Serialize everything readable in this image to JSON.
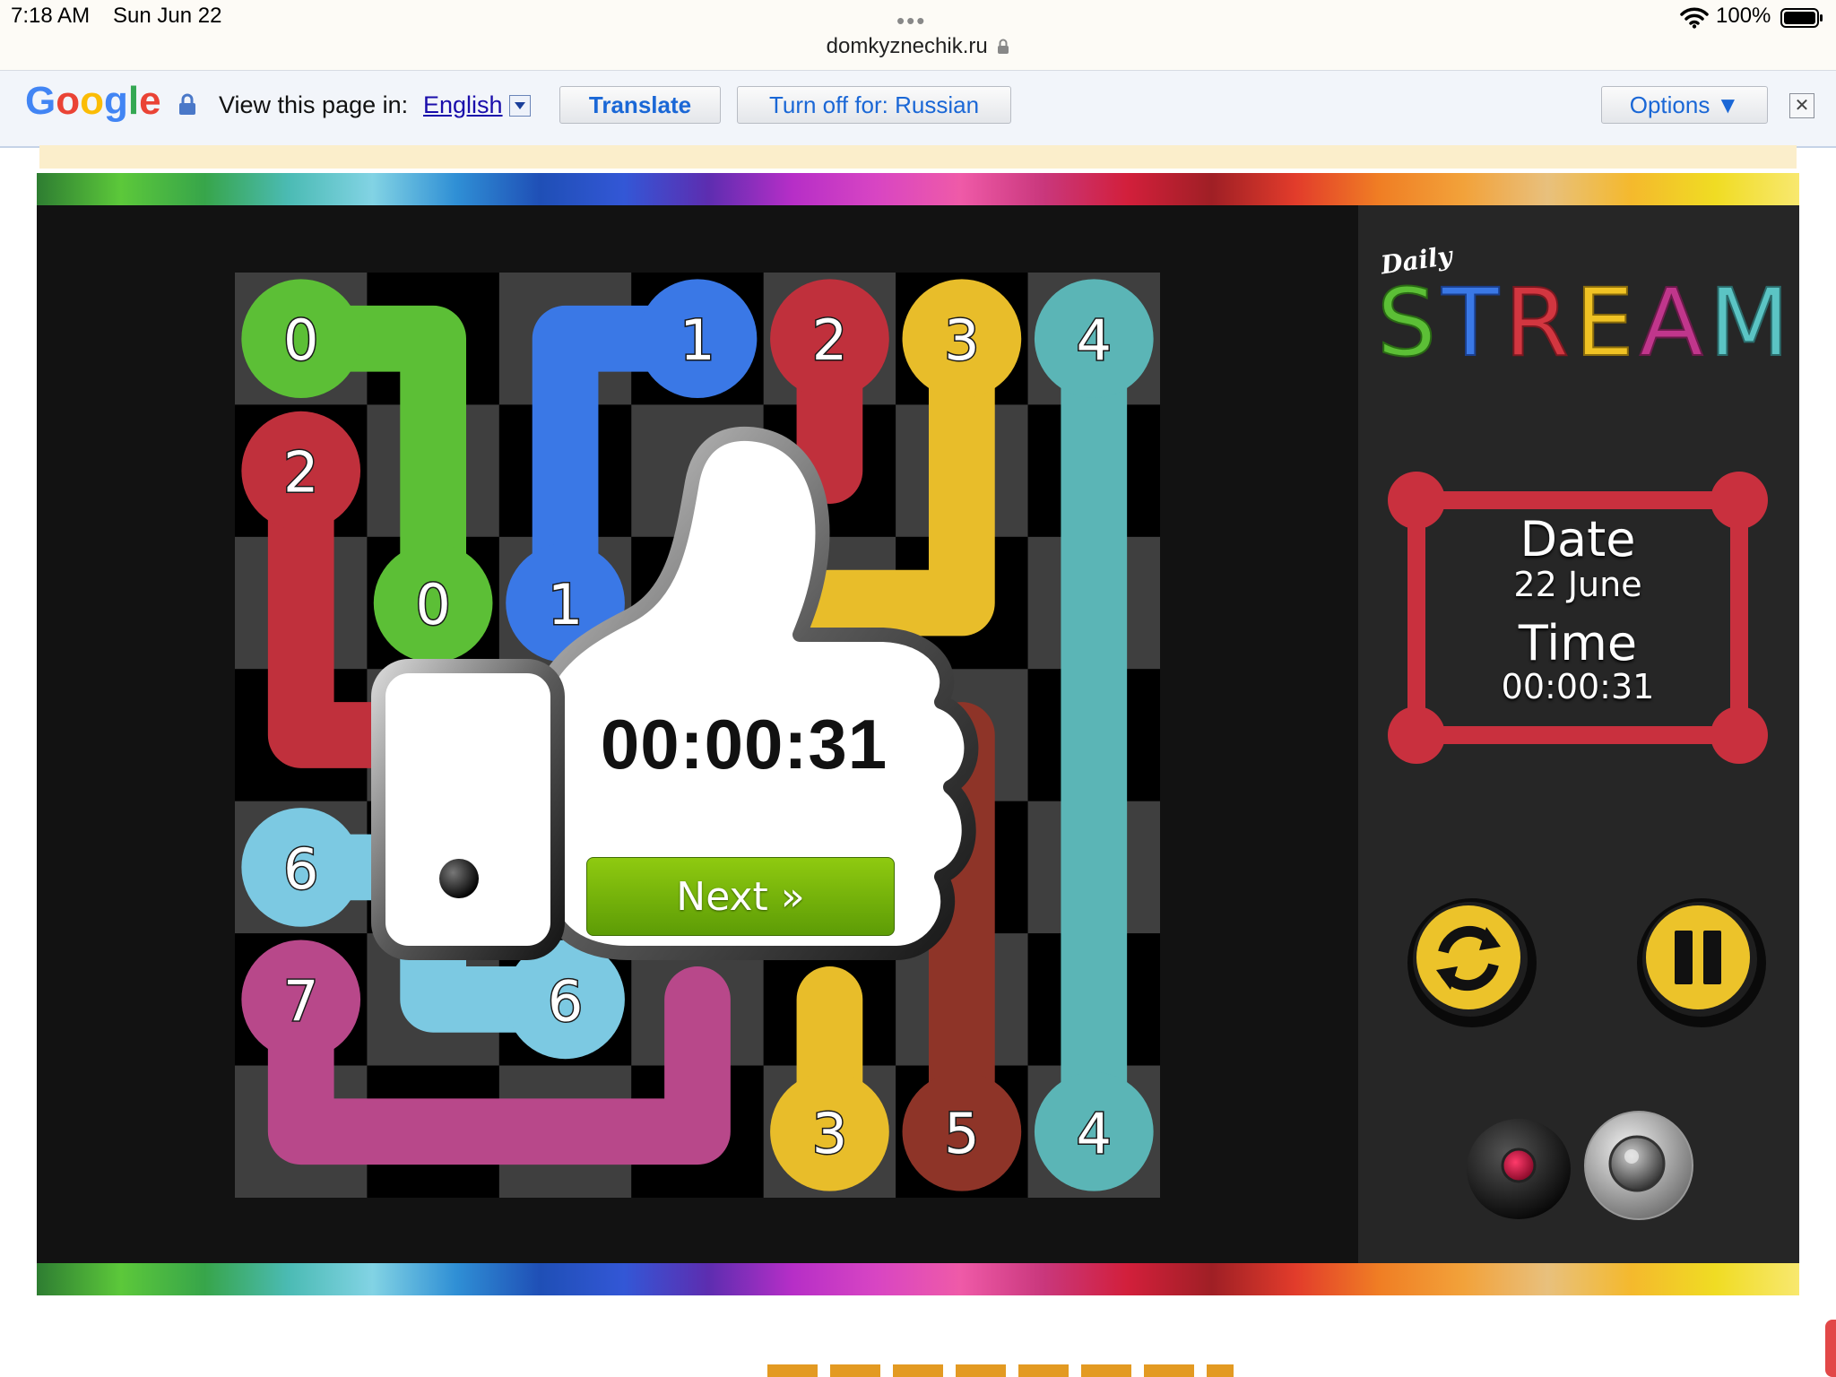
{
  "status_bar": {
    "time": "7:18 AM",
    "date": "Sun Jun 22",
    "dots": "•••",
    "url": "domkyznechik.ru",
    "battery": "100%"
  },
  "translate_bar": {
    "logo": "Google",
    "view_label": "View this page in:",
    "language": "English",
    "translate_button": "Translate",
    "turn_off_button": "Turn off for: Russian",
    "options_button": "Options ▼",
    "close_symbol": "✕"
  },
  "game": {
    "logo_small": "Daily",
    "logo_big": "STREAM",
    "date_label": "Date",
    "date_value": "22 June",
    "time_label": "Time",
    "time_value": "00:00:31",
    "popup_time": "00:00:31",
    "next_button": "Next »",
    "grid": {
      "rows": 7,
      "cols": 7,
      "endpoints": [
        {
          "label": "0",
          "row": 0,
          "col": 0,
          "color": "#5cbf36"
        },
        {
          "label": "0",
          "row": 2,
          "col": 1,
          "color": "#5cbf36"
        },
        {
          "label": "1",
          "row": 0,
          "col": 3,
          "color": "#3a78e6"
        },
        {
          "label": "1",
          "row": 2,
          "col": 2,
          "color": "#3a78e6"
        },
        {
          "label": "2",
          "row": 0,
          "col": 4,
          "color": "#c0303c"
        },
        {
          "label": "2",
          "row": 1,
          "col": 0,
          "color": "#c0303c"
        },
        {
          "label": "3",
          "row": 0,
          "col": 5,
          "color": "#e8bd2a"
        },
        {
          "label": "3",
          "row": 6,
          "col": 4,
          "color": "#e8bd2a"
        },
        {
          "label": "4",
          "row": 0,
          "col": 6,
          "color": "#5bb5b6"
        },
        {
          "label": "4",
          "row": 6,
          "col": 6,
          "color": "#5bb5b6"
        },
        {
          "label": "5",
          "row": 6,
          "col": 5,
          "color": "#8e3428"
        },
        {
          "label": "6",
          "row": 4,
          "col": 0,
          "color": "#7cc9e2"
        },
        {
          "label": "6",
          "row": 5,
          "col": 2,
          "color": "#7cc9e2"
        },
        {
          "label": "7",
          "row": 5,
          "col": 0,
          "color": "#b8488a"
        }
      ],
      "paths": [
        {
          "id": "0",
          "color": "#5cbf36",
          "cells": [
            [
              0,
              0
            ],
            [
              0,
              1
            ],
            [
              1,
              1
            ],
            [
              2,
              1
            ]
          ]
        },
        {
          "id": "1",
          "color": "#3a78e6",
          "cells": [
            [
              0,
              3
            ],
            [
              0,
              2
            ],
            [
              1,
              2
            ],
            [
              2,
              2
            ]
          ]
        },
        {
          "id": "2",
          "color": "#c0303c",
          "cells": [
            [
              1,
              0
            ],
            [
              2,
              0
            ],
            [
              3,
              0
            ],
            [
              3,
              1
            ]
          ]
        },
        {
          "id": "2b",
          "color": "#c0303c",
          "cells": [
            [
              0,
              4
            ],
            [
              1,
              4
            ]
          ]
        },
        {
          "id": "3",
          "color": "#e8bd2a",
          "cells": [
            [
              0,
              5
            ],
            [
              1,
              5
            ],
            [
              2,
              5
            ],
            [
              2,
              4
            ]
          ]
        },
        {
          "id": "3b",
          "color": "#e8bd2a",
          "cells": [
            [
              6,
              4
            ],
            [
              5,
              4
            ]
          ]
        },
        {
          "id": "4",
          "color": "#5bb5b6",
          "cells": [
            [
              0,
              6
            ],
            [
              6,
              6
            ]
          ]
        },
        {
          "id": "5",
          "color": "#8e3428",
          "cells": [
            [
              6,
              5
            ],
            [
              3,
              5
            ]
          ]
        },
        {
          "id": "6",
          "color": "#7cc9e2",
          "cells": [
            [
              4,
              0
            ],
            [
              4,
              1
            ],
            [
              5,
              1
            ],
            [
              5,
              2
            ]
          ]
        },
        {
          "id": "7",
          "color": "#b8488a",
          "cells": [
            [
              5,
              0
            ],
            [
              6,
              0
            ],
            [
              6,
              3
            ],
            [
              5,
              3
            ]
          ]
        }
      ]
    },
    "buttons": {
      "restart": "restart-icon",
      "pause": "pause-icon",
      "record": "record-icon",
      "sound": "speaker-icon"
    }
  },
  "colors": {
    "green": "#5cbf36",
    "blue": "#3a78e6",
    "red": "#c0303c",
    "yellow": "#e8bd2a",
    "teal": "#5bb5b6",
    "brown": "#8e3428",
    "light_blue": "#7cc9e2",
    "magenta": "#b8488a",
    "google_blue": "#4285F4",
    "google_red": "#EA4335",
    "google_yellow": "#FBBC05",
    "google_green": "#34A853"
  }
}
